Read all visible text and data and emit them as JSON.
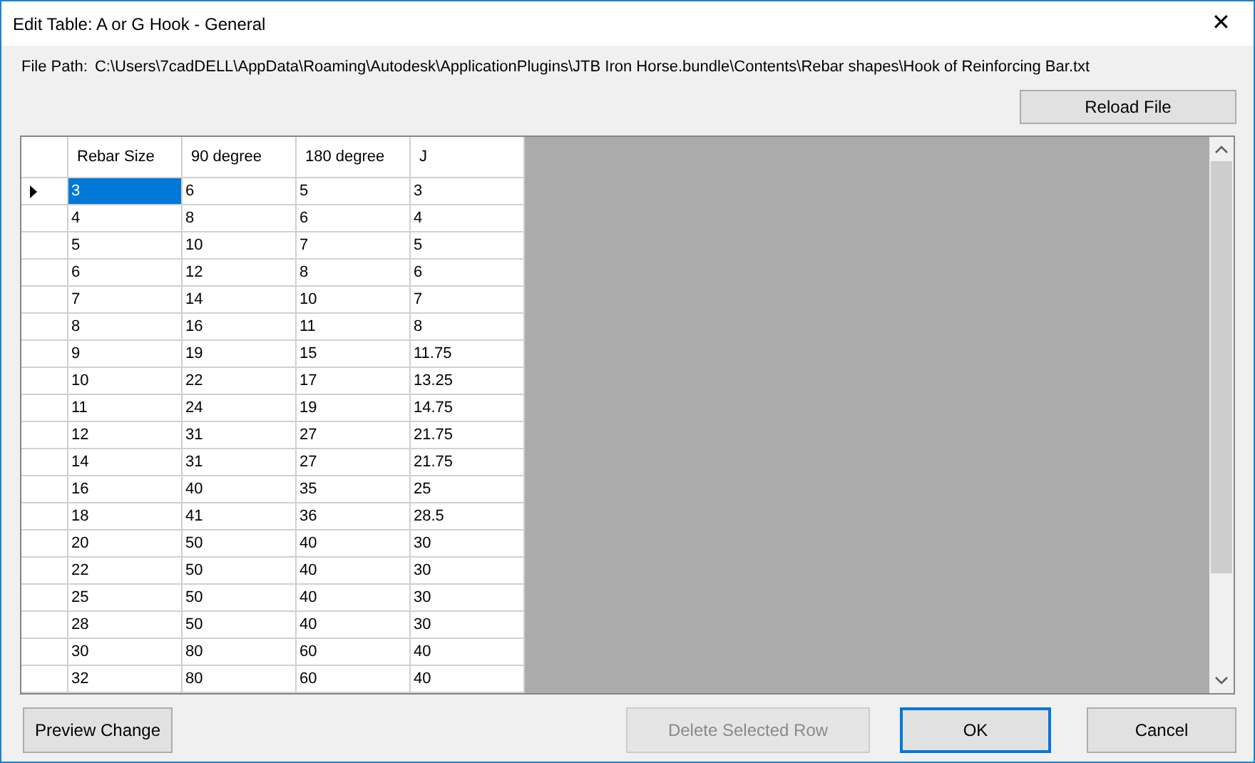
{
  "window": {
    "title": "Edit Table: A or G Hook - General",
    "close": "✕"
  },
  "file_path": {
    "label": "File Path:",
    "value": "C:\\Users\\7cadDELL\\AppData\\Roaming\\Autodesk\\ApplicationPlugins\\JTB Iron Horse.bundle\\Contents\\Rebar shapes\\Hook of Reinforcing Bar.txt"
  },
  "reload_button": {
    "label": "Reload File"
  },
  "table": {
    "columns": [
      "Rebar Size",
      "90 degree",
      "180 degree",
      "J"
    ],
    "rows": [
      {
        "selected": true,
        "cells": [
          "3",
          "6",
          "5",
          "3"
        ]
      },
      {
        "selected": false,
        "cells": [
          "4",
          "8",
          "6",
          "4"
        ]
      },
      {
        "selected": false,
        "cells": [
          "5",
          "10",
          "7",
          "5"
        ]
      },
      {
        "selected": false,
        "cells": [
          "6",
          "12",
          "8",
          "6"
        ]
      },
      {
        "selected": false,
        "cells": [
          "7",
          "14",
          "10",
          "7"
        ]
      },
      {
        "selected": false,
        "cells": [
          "8",
          "16",
          "11",
          "8"
        ]
      },
      {
        "selected": false,
        "cells": [
          "9",
          "19",
          "15",
          "11.75"
        ]
      },
      {
        "selected": false,
        "cells": [
          "10",
          "22",
          "17",
          "13.25"
        ]
      },
      {
        "selected": false,
        "cells": [
          "11",
          "24",
          "19",
          "14.75"
        ]
      },
      {
        "selected": false,
        "cells": [
          "12",
          "31",
          "27",
          "21.75"
        ]
      },
      {
        "selected": false,
        "cells": [
          "14",
          "31",
          "27",
          "21.75"
        ]
      },
      {
        "selected": false,
        "cells": [
          "16",
          "40",
          "35",
          "25"
        ]
      },
      {
        "selected": false,
        "cells": [
          "18",
          "41",
          "36",
          "28.5"
        ]
      },
      {
        "selected": false,
        "cells": [
          "20",
          "50",
          "40",
          "30"
        ]
      },
      {
        "selected": false,
        "cells": [
          "22",
          "50",
          "40",
          "30"
        ]
      },
      {
        "selected": false,
        "cells": [
          "25",
          "50",
          "40",
          "30"
        ]
      },
      {
        "selected": false,
        "cells": [
          "28",
          "50",
          "40",
          "30"
        ]
      },
      {
        "selected": false,
        "cells": [
          "30",
          "80",
          "60",
          "40"
        ]
      },
      {
        "selected": false,
        "cells": [
          "32",
          "80",
          "60",
          "40"
        ]
      }
    ]
  },
  "buttons": [
    {
      "label": "Preview Change",
      "disabled": false,
      "focused": false
    },
    {
      "label": "Delete Selected Row",
      "disabled": true,
      "focused": false
    },
    {
      "label": "OK",
      "disabled": false,
      "focused": true
    },
    {
      "label": "Cancel",
      "disabled": false,
      "focused": false
    }
  ]
}
